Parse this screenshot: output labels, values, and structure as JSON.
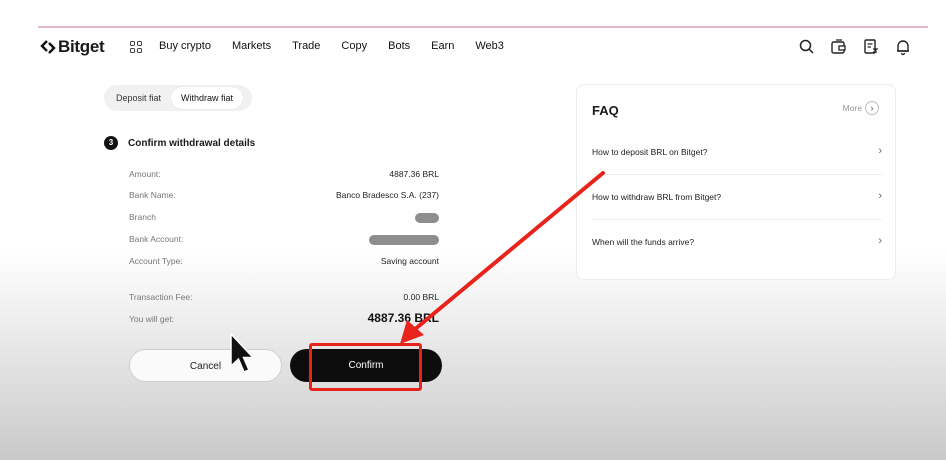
{
  "header": {
    "logo_text": "Bitget",
    "nav": [
      "Buy crypto",
      "Markets",
      "Trade",
      "Copy",
      "Bots",
      "Earn",
      "Web3"
    ],
    "icons": [
      "search-icon",
      "wallet-icon",
      "orders-icon",
      "bell-icon"
    ]
  },
  "tabs": [
    {
      "label": "Deposit fiat",
      "active": false
    },
    {
      "label": "Withdraw fiat",
      "active": true
    }
  ],
  "step": {
    "number": "3",
    "title": "Confirm withdrawal details"
  },
  "details": {
    "amount_label": "Amount:",
    "amount_value": "4887.36 BRL",
    "bank_name_label": "Bank Name:",
    "bank_name_value": "Banco Bradesco S.A. (237)",
    "branch_label": "Branch",
    "bank_account_label": "Bank Account:",
    "account_type_label": "Account Type:",
    "account_type_value": "Saving account",
    "fee_label": "Transaction Fee:",
    "fee_value": "0.00 BRL",
    "get_label": "You will get:",
    "get_value": "4887.36 BRL"
  },
  "buttons": {
    "cancel": "Cancel",
    "confirm": "Confirm"
  },
  "faq": {
    "title": "FAQ",
    "more": "More",
    "items": [
      "How to deposit BRL on Bitget?",
      "How to withdraw BRL from Bitget?",
      "When will the funds arrive?"
    ]
  },
  "colors": {
    "highlight": "#e8231c",
    "primary": "#0d0d0d"
  }
}
